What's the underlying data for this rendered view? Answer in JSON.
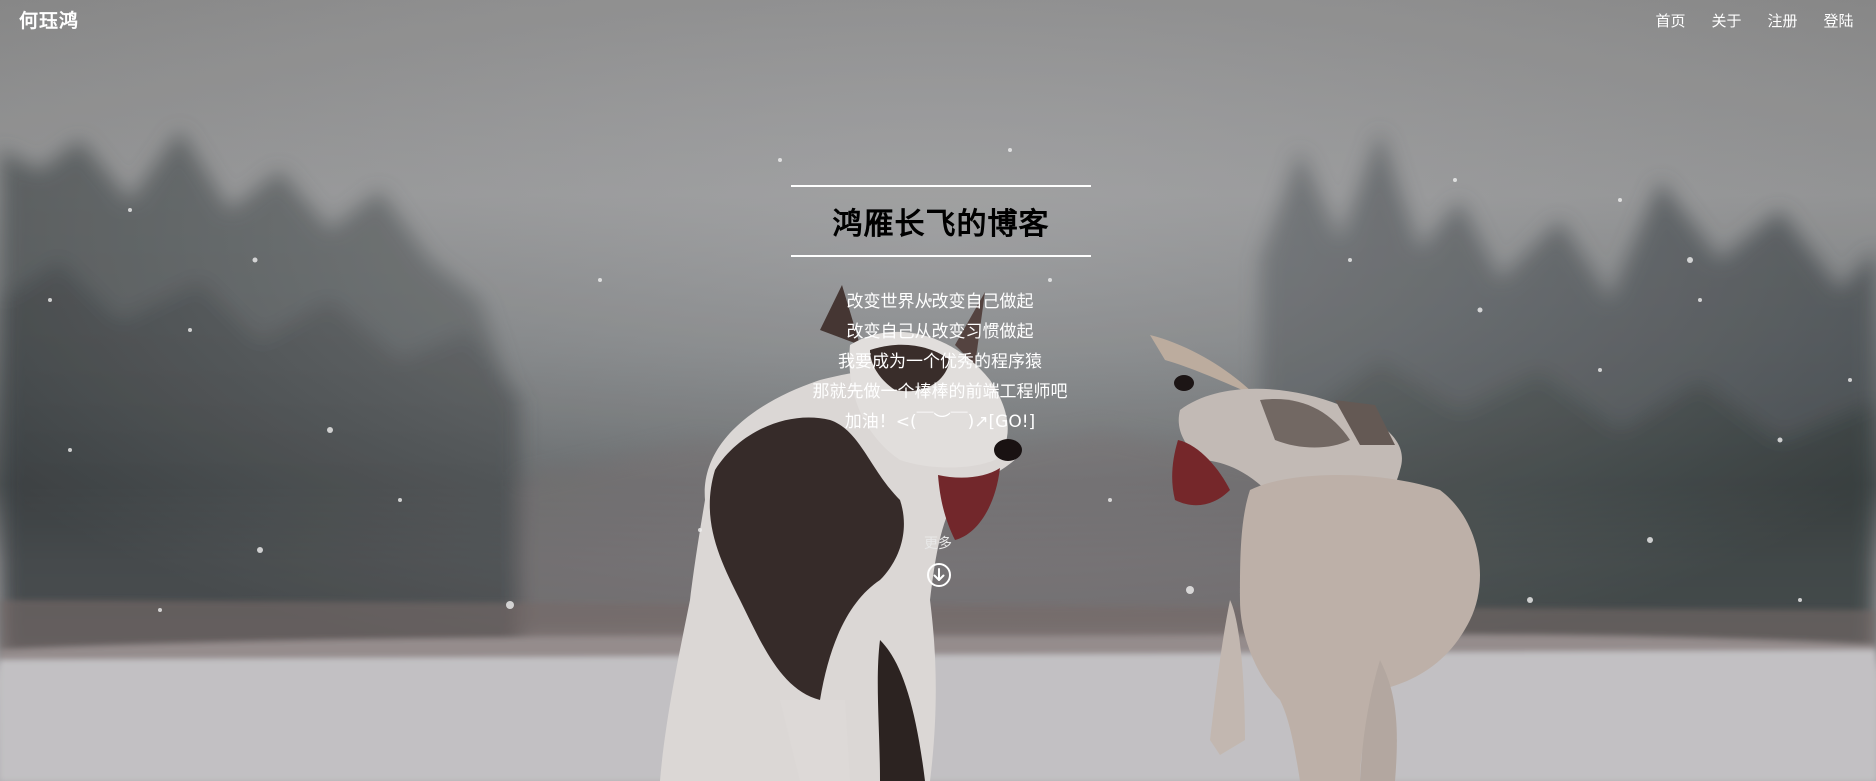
{
  "navbar": {
    "brand": "何珏鸿",
    "links": [
      {
        "label": "首页"
      },
      {
        "label": "关于"
      },
      {
        "label": "注册"
      },
      {
        "label": "登陆"
      }
    ]
  },
  "hero": {
    "title": "鸿雁长飞的博客",
    "motto_lines": [
      "改变世界从改变自己做起",
      "改变自己从改变习惯做起",
      "我要成为一个优秀的程序猿",
      "那就先做一个棒棒的前端工程师吧",
      "加油！<(￣︶￣)↗[GO!]"
    ],
    "more_label": "更多",
    "scroll_icon": "arrow-down-circle-icon",
    "background_image": "two husky puppies playing in falling snow, forest behind"
  },
  "colors": {
    "text": "#ffffff",
    "title": "#000000",
    "rule": "#ffffff"
  }
}
